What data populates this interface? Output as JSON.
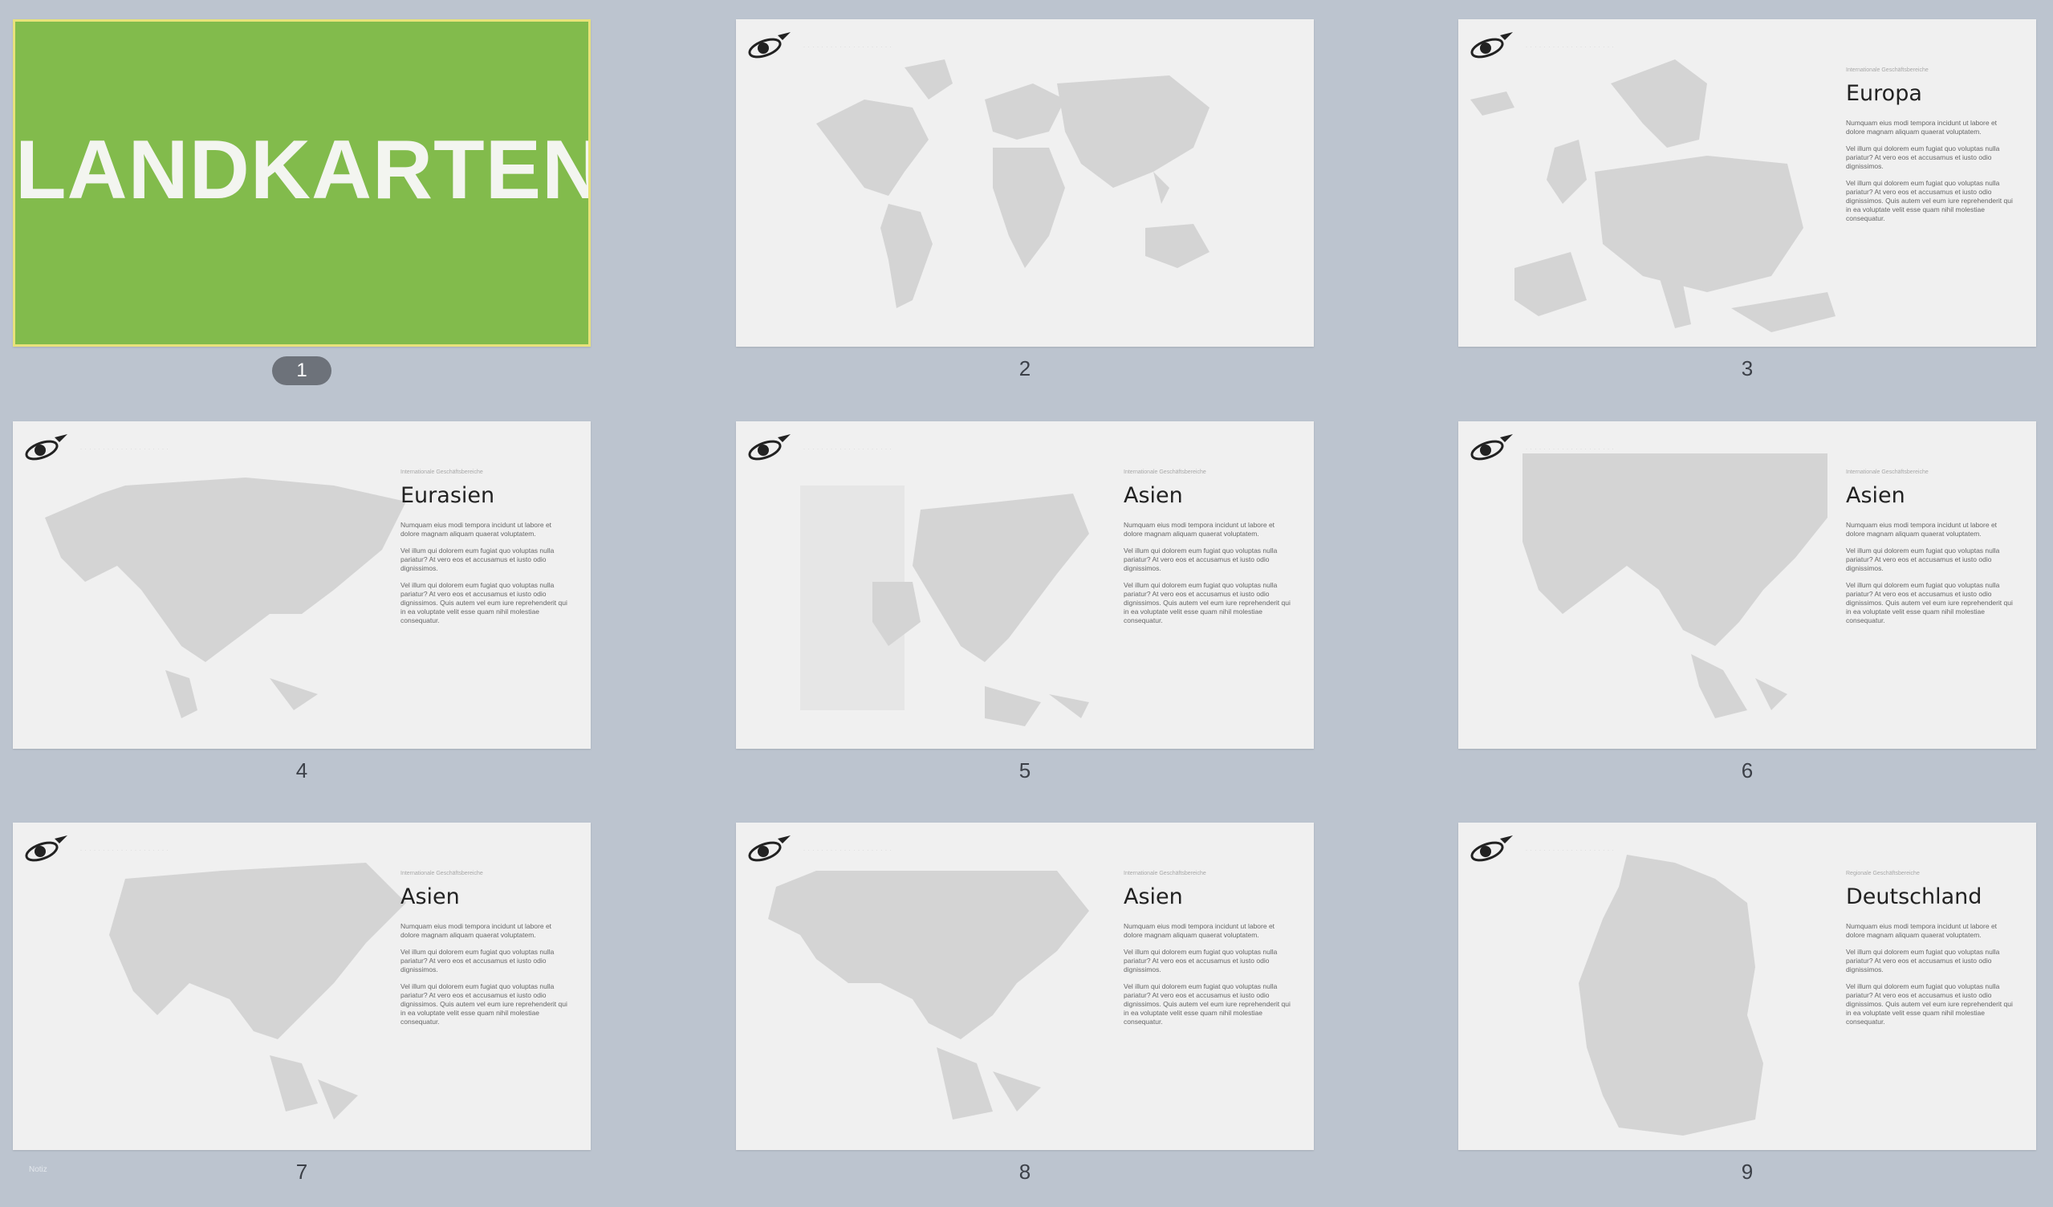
{
  "slides": [
    {
      "number": "1",
      "title": "LANDKARTEN",
      "selected": true
    },
    {
      "number": "2",
      "map": "world-map"
    },
    {
      "number": "3",
      "map": "europe-map",
      "kicker": "Internationale Geschäftsbereiche",
      "heading": "Europa",
      "p1": "Numquam eius modi tempora incidunt ut labore et dolore magnam aliquam quaerat voluptatem.",
      "p2": "Vel illum qui dolorem eum fugiat quo voluptas nulla pariatur? At vero eos et accusamus et iusto odio dignissimos.",
      "p3": "Vel illum qui dolorem eum fugiat quo voluptas nulla pariatur? At vero eos et accusamus et iusto odio dignissimos. Quis autem vel eum iure reprehenderit qui in ea voluptate velit esse quam nihil molestiae consequatur."
    },
    {
      "number": "4",
      "map": "eurasia-map",
      "kicker": "Internationale Geschäftsbereiche",
      "heading": "Eurasien",
      "p1": "Numquam eius modi tempora incidunt ut labore et dolore magnam aliquam quaerat voluptatem.",
      "p2": "Vel illum qui dolorem eum fugiat quo voluptas nulla pariatur? At vero eos et accusamus et iusto odio dignissimos.",
      "p3": "Vel illum qui dolorem eum fugiat quo voluptas nulla pariatur? At vero eos et accusamus et iusto odio dignissimos. Quis autem vel eum iure reprehenderit qui in ea voluptate velit esse quam nihil molestiae consequatur."
    },
    {
      "number": "5",
      "map": "asia-map",
      "kicker": "Internationale Geschäftsbereiche",
      "heading": "Asien",
      "p1": "Numquam eius modi tempora incidunt ut labore et dolore magnam aliquam quaerat voluptatem.",
      "p2": "Vel illum qui dolorem eum fugiat quo voluptas nulla pariatur? At vero eos et accusamus et iusto odio dignissimos.",
      "p3": "Vel illum qui dolorem eum fugiat quo voluptas nulla pariatur? At vero eos et accusamus et iusto odio dignissimos. Quis autem vel eum iure reprehenderit qui in ea voluptate velit esse quam nihil molestiae consequatur."
    },
    {
      "number": "6",
      "map": "asia-map",
      "kicker": "Internationale Geschäftsbereiche",
      "heading": "Asien",
      "p1": "Numquam eius modi tempora incidunt ut labore et dolore magnam aliquam quaerat voluptatem.",
      "p2": "Vel illum qui dolorem eum fugiat quo voluptas nulla pariatur? At vero eos et accusamus et iusto odio dignissimos.",
      "p3": "Vel illum qui dolorem eum fugiat quo voluptas nulla pariatur? At vero eos et accusamus et iusto odio dignissimos. Quis autem vel eum iure reprehenderit qui in ea voluptate velit esse quam nihil molestiae consequatur."
    },
    {
      "number": "7",
      "map": "asia-map",
      "kicker": "Internationale Geschäftsbereiche",
      "heading": "Asien",
      "p1": "Numquam eius modi tempora incidunt ut labore et dolore magnam aliquam quaerat voluptatem.",
      "p2": "Vel illum qui dolorem eum fugiat quo voluptas nulla pariatur? At vero eos et accusamus et iusto odio dignissimos.",
      "p3": "Vel illum qui dolorem eum fugiat quo voluptas nulla pariatur? At vero eos et accusamus et iusto odio dignissimos. Quis autem vel eum iure reprehenderit qui in ea voluptate velit esse quam nihil molestiae consequatur."
    },
    {
      "number": "8",
      "map": "asia-map",
      "kicker": "Internationale Geschäftsbereiche",
      "heading": "Asien",
      "p1": "Numquam eius modi tempora incidunt ut labore et dolore magnam aliquam quaerat voluptatem.",
      "p2": "Vel illum qui dolorem eum fugiat quo voluptas nulla pariatur? At vero eos et accusamus et iusto odio dignissimos.",
      "p3": "Vel illum qui dolorem eum fugiat quo voluptas nulla pariatur? At vero eos et accusamus et iusto odio dignissimos. Quis autem vel eum iure reprehenderit qui in ea voluptate velit esse quam nihil molestiae consequatur."
    },
    {
      "number": "9",
      "map": "germany-map",
      "kicker": "Regionale Geschäftsbereiche",
      "heading": "Deutschland",
      "p1": "Numquam eius modi tempora incidunt ut labore et dolore magnam aliquam quaerat voluptatem.",
      "p2": "Vel illum qui dolorem eum fugiat quo voluptas nulla pariatur? At vero eos et accusamus et iusto odio dignissimos.",
      "p3": "Vel illum qui dolorem eum fugiat quo voluptas nulla pariatur? At vero eos et accusamus et iusto odio dignissimos. Quis autem vel eum iure reprehenderit qui in ea voluptate velit esse quam nihil molestiae consequatur."
    }
  ],
  "colors": {
    "background": "#bcc4cf",
    "title_slide": "#82bb4c",
    "selection": "#e8e27a",
    "map_fill": "#d4d4d4"
  },
  "footer": {
    "note": "Notiz"
  }
}
